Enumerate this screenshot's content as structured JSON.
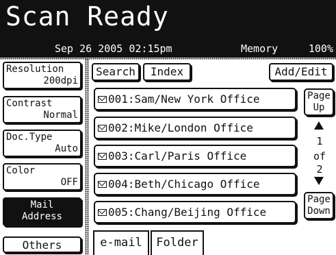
{
  "header": {
    "title": "Scan Ready",
    "date": "Sep 26 2005 02:15pm",
    "memory_label": "Memory",
    "memory_pct": "100%"
  },
  "sidebar": {
    "items": [
      {
        "label": "Resolution",
        "value": "200dpi"
      },
      {
        "label": "Contrast",
        "value": "Normal"
      },
      {
        "label": "Doc.Type",
        "value": "Auto"
      },
      {
        "label": "Color",
        "value": "OFF"
      },
      {
        "label": "Mail",
        "value": "Address",
        "active": true
      }
    ],
    "others": "Others"
  },
  "toolbar": {
    "search": "Search",
    "index": "Index",
    "add_edit": "Add/Edit"
  },
  "entries": [
    "001:Sam/New York Office",
    "002:Mike/London Office",
    "003:Carl/Paris Office",
    "004:Beth/Chicago Office",
    "005:Chang/Beijing Office"
  ],
  "paging": {
    "page_up_1": "Page",
    "page_up_2": "Up",
    "current": "1",
    "of": "of",
    "total": "2",
    "page_down_1": "Page",
    "page_down_2": "Down"
  },
  "tabs": {
    "email": "e-mail",
    "folder": "Folder"
  },
  "icons": {
    "entry_icon": "envelope-icon",
    "up": "up-triangle-icon",
    "down": "down-triangle-icon"
  }
}
